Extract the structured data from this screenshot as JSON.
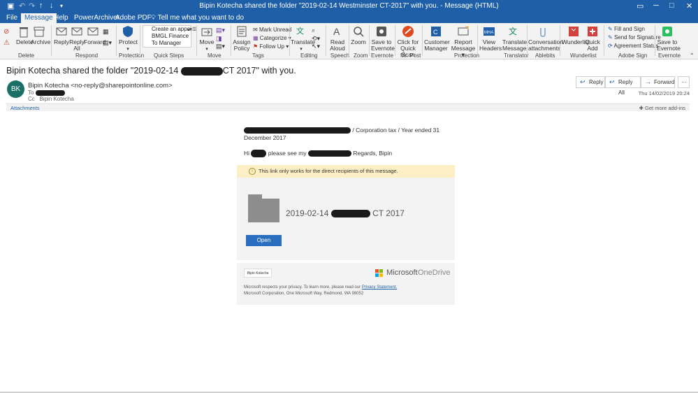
{
  "window": {
    "title": "Bipin Kotecha shared the folder \"2019-02-14 Westminster CT-2017\" with you. - Message (HTML)",
    "controls": [
      "restore-icon",
      "minimize-icon",
      "maximize-icon",
      "close-icon"
    ]
  },
  "quick_access": [
    "save-icon",
    "undo-icon",
    "redo-icon",
    "up-arrow-icon",
    "down-arrow-icon",
    "customize-icon"
  ],
  "tabs": [
    {
      "label": "File"
    },
    {
      "label": "Message",
      "active": true
    },
    {
      "label": "Help"
    },
    {
      "label": "PowerArchiver"
    },
    {
      "label": "Adobe PDF"
    }
  ],
  "tellme": "Tell me what you want to do",
  "ribbon": {
    "buttons": [
      {
        "label": "Delete"
      },
      {
        "label": "Archive"
      },
      {
        "label": "Reply"
      },
      {
        "label": "Reply All"
      },
      {
        "label": "Forward"
      },
      {
        "label": "Protect"
      },
      {
        "label": "Move"
      },
      {
        "label": "Assign Policy"
      },
      {
        "label": "Translate"
      },
      {
        "label": "Read Aloud"
      },
      {
        "label": "Zoom"
      },
      {
        "label": "Save to Evernote"
      },
      {
        "label": "Click for Quick Scan"
      },
      {
        "label": "Customer Manager"
      },
      {
        "label": "Report Message"
      },
      {
        "label": "View Headers"
      },
      {
        "label": "Translate Message"
      },
      {
        "label": "Conversation attachments"
      },
      {
        "label": "Wunderlist"
      },
      {
        "label": "Quick Add"
      },
      {
        "label": "Save to Evernote"
      }
    ],
    "quick_steps": [
      "Create an appoi...",
      "BMGL Finance",
      "To Manager"
    ],
    "tags": {
      "mark_unread": "Mark Unread",
      "categorize": "Categorize",
      "follow_up": "Follow Up"
    },
    "adobe_sign": {
      "fill_sign": "Fill and Sign",
      "send_signature": "Send for Signature",
      "agreement_status": "Agreement Status"
    },
    "groups": [
      "Delete",
      "Respond",
      "Protection",
      "Quick Steps",
      "Move",
      "Tags",
      "Editing",
      "Speech",
      "Zoom",
      "Evernote",
      "Mr. Post",
      "Protection",
      "Translator",
      "Ablebits",
      "Wunderlist",
      "Adobe Sign",
      "Evernote"
    ]
  },
  "message": {
    "subject_prefix": "Bipin Kotecha shared the folder \"2019-02-14 ",
    "subject_suffix": "CT 2017\" with you.",
    "avatar_initials": "BK",
    "from": "Bipin Kotecha <no-reply@sharepointonline.com>",
    "to_label": "To",
    "cc_label": "Cc",
    "cc_value": "Bipin Kotecha",
    "actions": {
      "reply": "Reply",
      "reply_all": "Reply All",
      "forward": "Forward"
    },
    "date": "Thu 14/02/2019 20:24",
    "attachments_label": "Attachments",
    "get_addins": "Get more add-ins"
  },
  "body": {
    "line1_suffix": "/ Corporation tax / Year ended 31 December 2017",
    "line2_prefix": "Hi",
    "line2_middle": "please see my",
    "line2_suffix": "Regards, Bipin",
    "warning": "This link only works for the direct recipients of this message.",
    "folder_prefix": "2019-02-14",
    "folder_suffix": "CT 2017",
    "open_button": "Open",
    "signature_text": "Bipin Kotecha",
    "ms_text": "Microsoft",
    "od_text": "OneDrive",
    "privacy_text": "Microsoft respects your privacy. To learn more, please read our",
    "privacy_link": "Privacy Statement.",
    "address": "Microsoft Corporation, One Microsoft Way, Redmond, WA 98052"
  },
  "colors": {
    "titlebar": "#1e5fa8",
    "avatar": "#1a6f67",
    "open_button": "#2a6ec0",
    "warning_bg": "#fcefc6"
  }
}
